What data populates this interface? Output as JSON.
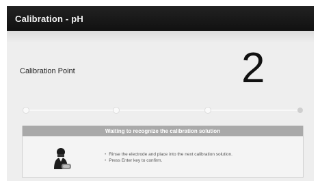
{
  "header": {
    "title": "Calibration - pH"
  },
  "calibration": {
    "label": "Calibration Point",
    "point_number": "2"
  },
  "progress": {
    "total_points": 4,
    "completed_points": 3,
    "current_point": 2
  },
  "panel": {
    "heading": "Waiting to recognize the calibration solution",
    "icon": "operator-with-electrode-icon",
    "instructions": [
      "Rinse the electrode and place into the next calibration solution.",
      "Press Enter key to confirm."
    ]
  },
  "colors": {
    "title_bar": "#111111",
    "panel_header": "#a9a9a9",
    "background": "#eeeeee"
  }
}
